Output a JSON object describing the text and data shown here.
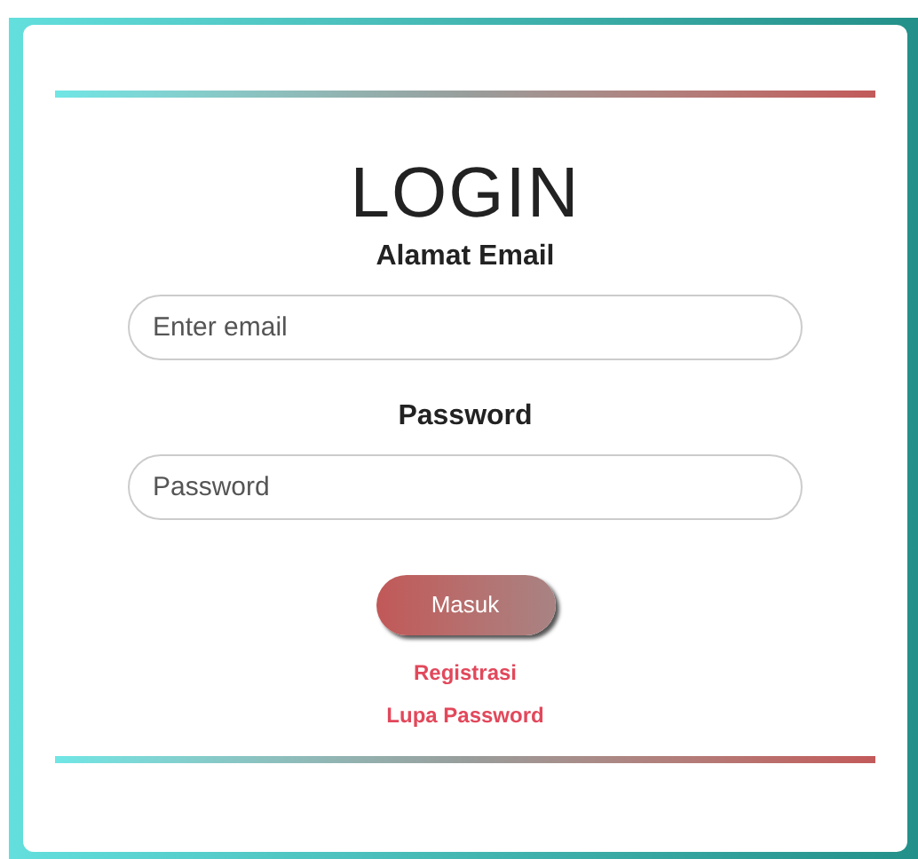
{
  "title": "LOGIN",
  "fields": [
    {
      "label": "Alamat Email",
      "placeholder": "Enter email"
    },
    {
      "label": "Password",
      "placeholder": "Password"
    }
  ],
  "submit": "Masuk",
  "links": [
    "Registrasi",
    "Lupa Password"
  ]
}
